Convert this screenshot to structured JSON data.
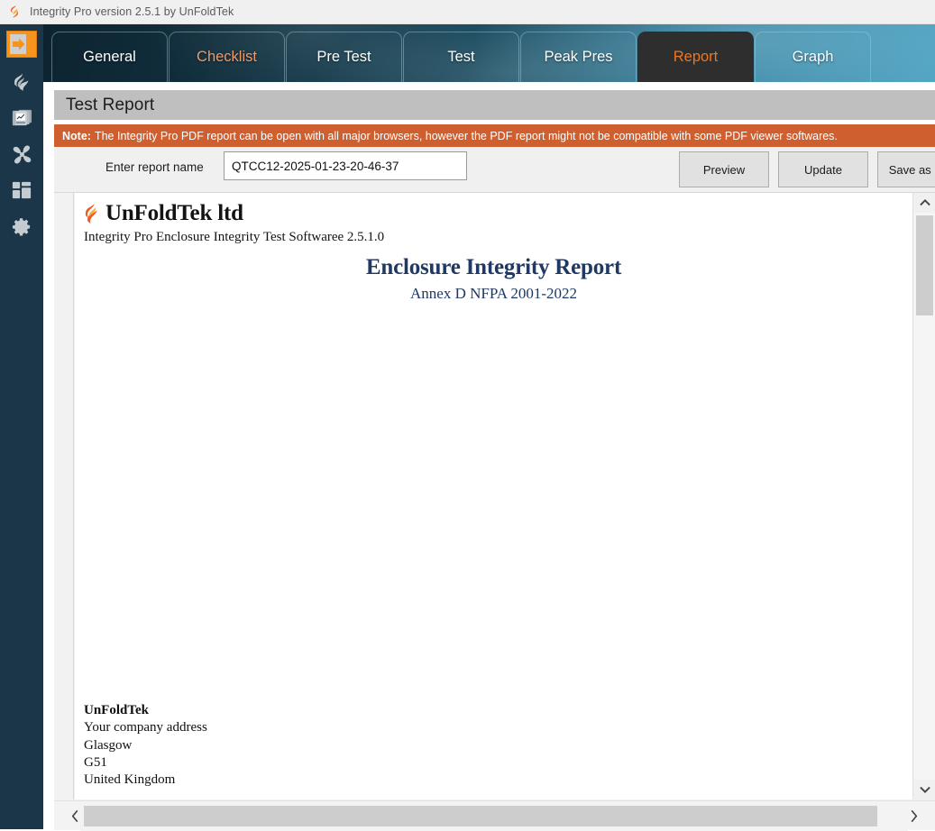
{
  "window": {
    "title": "Integrity Pro version 2.5.1 by UnFoldTek",
    "app_icon": "flame-logo-icon"
  },
  "theme": {
    "accent_orange": "#f0761e",
    "note_bar_bg": "#cf5f2e",
    "rail_bg": "#1b3648",
    "active_tab_bg": "#2e2e2e",
    "report_heading_blue": "#1f3864",
    "section_header_bg": "#bfbfbf"
  },
  "sidebar": {
    "items": [
      {
        "icon": "expand-arrow-icon",
        "name": "expand-menu"
      },
      {
        "icon": "flame-icon",
        "name": "agent-suppression"
      },
      {
        "icon": "chart-document-icon",
        "name": "reports"
      },
      {
        "icon": "fan-icon",
        "name": "fan-blower"
      },
      {
        "icon": "dashboard-grid-icon",
        "name": "dashboard"
      },
      {
        "icon": "gear-icon",
        "name": "settings"
      }
    ]
  },
  "tabs": [
    {
      "label": "General",
      "state": "normal"
    },
    {
      "label": "Checklist",
      "state": "hovered"
    },
    {
      "label": "Pre Test",
      "state": "normal"
    },
    {
      "label": "Test",
      "state": "normal"
    },
    {
      "label": "Peak Pres",
      "state": "normal"
    },
    {
      "label": "Report",
      "state": "active"
    },
    {
      "label": "Graph",
      "state": "normal"
    }
  ],
  "section": {
    "title": "Test Report"
  },
  "note": {
    "label": "Note:",
    "text": "The Integrity Pro PDF report can be open with all major browsers, however the PDF report might not be compatible with some PDF viewer softwares."
  },
  "toolbar": {
    "report_name_label": "Enter report name",
    "report_name_value": "QTCC12-2025-01-23-20-46-37",
    "report_name_placeholder": "Enter report name",
    "preview_label": "Preview",
    "update_label": "Update",
    "save_pdf_label": "Save as PDF"
  },
  "report": {
    "company": "UnFoldTek ltd",
    "software_line": "Integrity Pro Enclosure Integrity Test Softwaree 2.5.1.0",
    "title": "Enclosure Integrity Report",
    "standard": "Annex D NFPA 2001-2022",
    "footer": {
      "name": "UnFoldTek",
      "address_line": "Your company address",
      "city": "Glasgow",
      "postcode": "G51",
      "country": "United Kingdom"
    }
  },
  "scrollbars": {
    "vertical": {
      "up_icon": "chevron-up-icon",
      "down_icon": "chevron-down-icon"
    },
    "horizontal": {
      "left_icon": "chevron-left-icon",
      "right_icon": "chevron-right-icon"
    }
  }
}
